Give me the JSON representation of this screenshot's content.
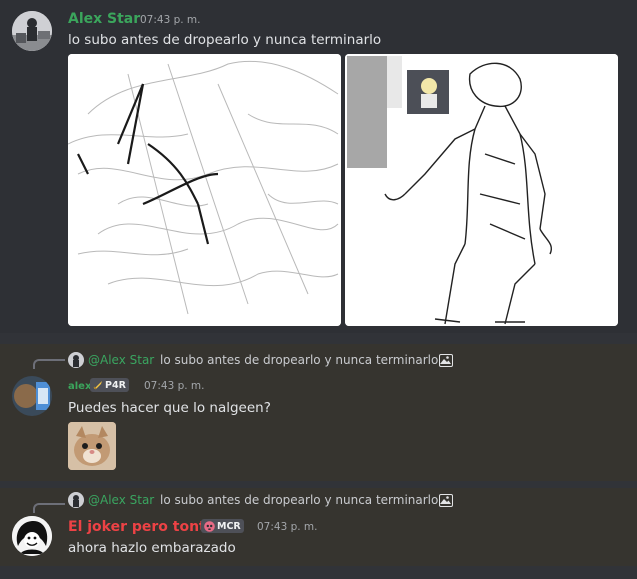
{
  "messages": [
    {
      "author": "Alex Star",
      "author_color": "#3ba55c",
      "timestamp": "07:43 p. m.",
      "content": "lo subo antes de dropearlo y nunca terminarlo",
      "attachments": [
        "sketch-image-1",
        "sketch-image-2"
      ]
    },
    {
      "reply": {
        "mention": "@Alex Star",
        "text": "lo subo antes de dropearlo y nunca terminarlo",
        "icon": "image-icon"
      },
      "author": "alex",
      "author_color": "#3ba55c",
      "badge": {
        "icon": "sword-icon",
        "label": "P4R"
      },
      "timestamp": "07:43 p. m.",
      "content": "Puedes hacer que lo nalgeen?",
      "attachments": [
        "cat-image"
      ]
    },
    {
      "reply": {
        "mention": "@Alex Star",
        "text": "lo subo antes de dropearlo y nunca terminarlo",
        "icon": "image-icon"
      },
      "author": "El joker pero tonto",
      "author_color": "#ed4245",
      "badge": {
        "icon": "skull-icon",
        "label": "MCR"
      },
      "timestamp": "07:43 p. m.",
      "content": "ahora hazlo embarazado"
    }
  ]
}
